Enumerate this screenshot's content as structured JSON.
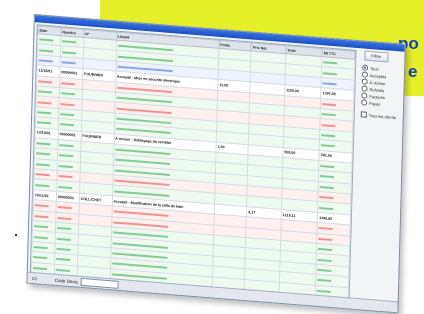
{
  "banner": {
    "line1": "po",
    "line2": "e",
    "color": "#1840b8",
    "bg": "#e6f02a"
  },
  "window": {
    "headers": [
      "Date",
      "Numéro",
      "N°",
      "Libellé",
      "Poids",
      "Prix Net",
      "Total",
      "Mt TTC"
    ],
    "rows": [
      {
        "kind": "green",
        "cells": [
          "",
          "",
          "",
          "",
          "",
          "",
          "",
          ""
        ]
      },
      {
        "kind": "green",
        "cells": [
          "",
          "",
          "",
          "",
          "",
          "",
          "",
          ""
        ]
      },
      {
        "kind": "blue",
        "cells": [
          "",
          "",
          "",
          "",
          "",
          "",
          "",
          ""
        ]
      },
      {
        "kind": "main",
        "cells": [
          "11/10/01",
          "00000001",
          "FOURNIER",
          "Accepté - Mise en sécurité électrique",
          "11,00",
          "",
          "1150,00",
          "1397,00"
        ]
      },
      {
        "kind": "red",
        "cells": [
          "",
          "",
          "",
          "",
          "",
          "",
          "",
          ""
        ]
      },
      {
        "kind": "green",
        "cells": [
          "",
          "",
          "",
          "",
          "",
          "",
          "",
          ""
        ]
      },
      {
        "kind": "red",
        "cells": [
          "",
          "",
          "",
          "",
          "",
          "",
          "",
          ""
        ]
      },
      {
        "kind": "green",
        "cells": [
          "",
          "",
          "",
          "",
          "",
          "",
          "",
          ""
        ]
      },
      {
        "kind": "green",
        "cells": [
          "",
          "",
          "",
          "",
          "",
          "",
          "",
          ""
        ]
      },
      {
        "kind": "main",
        "cells": [
          "13/10/01",
          "00000002",
          "FOURNIER",
          "A réviser - Déblayage du remblai",
          "1,00",
          "",
          "505,00",
          "581,00"
        ]
      },
      {
        "kind": "green",
        "cells": [
          "",
          "",
          "",
          "",
          "",
          "",
          "",
          ""
        ]
      },
      {
        "kind": "green",
        "cells": [
          "",
          "",
          "",
          "",
          "",
          "",
          "",
          ""
        ]
      },
      {
        "kind": "green",
        "cells": [
          "",
          "",
          "",
          "",
          "",
          "",
          "",
          ""
        ]
      },
      {
        "kind": "red",
        "cells": [
          "",
          "",
          "",
          "",
          "",
          "",
          "",
          ""
        ]
      },
      {
        "kind": "green",
        "cells": [
          "",
          "",
          "",
          "",
          "",
          "",
          "",
          ""
        ]
      },
      {
        "kind": "main",
        "cells": [
          "15/11/01",
          "00000003",
          "COLLICHET",
          "Accepté - Modification de la salle de bain",
          "",
          "4,17",
          "1215,11",
          "1340,85"
        ]
      },
      {
        "kind": "red",
        "cells": [
          "",
          "",
          "",
          "",
          "",
          "",
          "",
          ""
        ]
      },
      {
        "kind": "red",
        "cells": [
          "",
          "",
          "",
          "",
          "",
          "",
          "",
          ""
        ]
      },
      {
        "kind": "green",
        "cells": [
          "",
          "",
          "",
          "",
          "",
          "",
          "",
          ""
        ]
      },
      {
        "kind": "green",
        "cells": [
          "",
          "",
          "",
          "",
          "",
          "",
          "",
          ""
        ]
      },
      {
        "kind": "green",
        "cells": [
          "",
          "",
          "",
          "",
          "",
          "",
          "",
          ""
        ]
      },
      {
        "kind": "green",
        "cells": [
          "",
          "",
          "",
          "",
          "",
          "",
          "",
          ""
        ]
      },
      {
        "kind": "green",
        "cells": [
          "",
          "",
          "",
          "",
          "",
          "",
          "",
          ""
        ]
      }
    ],
    "side": {
      "button_label": "Filtrer",
      "radios": [
        "Tous",
        "Acceptés",
        "À réviser",
        "Refusés",
        "Facturés",
        "Payés"
      ],
      "selected_radio": 0,
      "checkbox_label": "Tous les clients"
    },
    "status": {
      "left_label": "13",
      "field_label": "Code Devis"
    }
  }
}
